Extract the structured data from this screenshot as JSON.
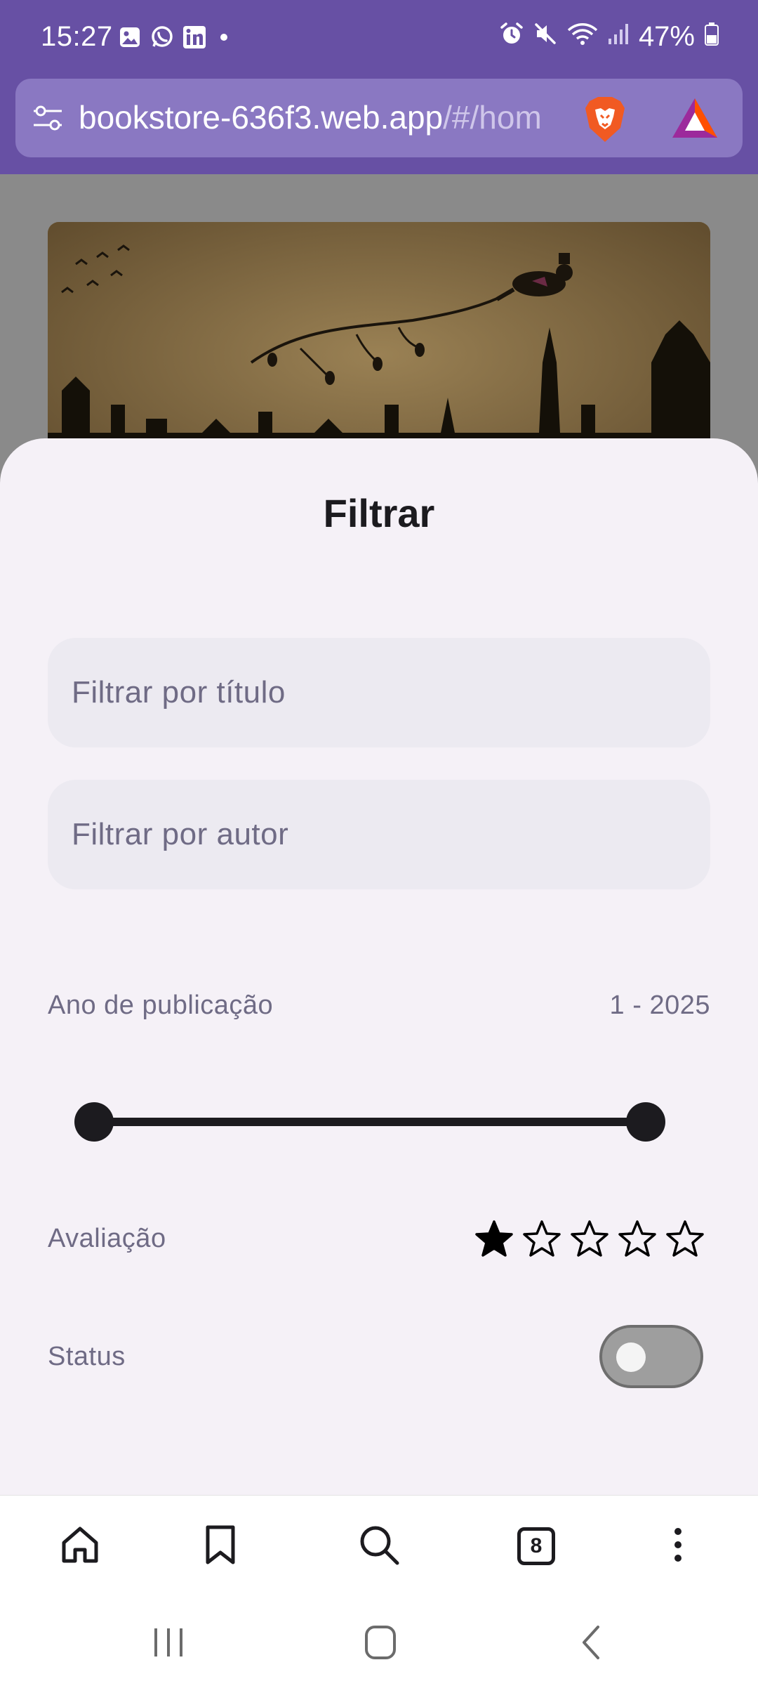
{
  "status_bar": {
    "time": "15:27",
    "battery": "47%",
    "icons": [
      "gallery-icon",
      "whatsapp-icon",
      "linkedin-icon",
      "alarm-icon",
      "mute-icon",
      "wifi-icon",
      "signal-icon",
      "battery-icon"
    ]
  },
  "address_bar": {
    "url_main": "bookstore-636f3.web.app",
    "url_path": "/#/hom"
  },
  "sheet": {
    "title": "Filtrar",
    "title_filter_placeholder": "Filtrar por título",
    "author_filter_placeholder": "Filtrar por autor",
    "year_label": "Ano de publicação",
    "year_range": "1 - 2025",
    "year_min": 1,
    "year_max": 2025,
    "rating_label": "Avaliação",
    "rating": 1,
    "rating_max": 5,
    "status_label": "Status",
    "status_on": false
  },
  "bottom_nav": {
    "tab_count": "8"
  },
  "colors": {
    "brand_purple": "#6750a4",
    "address_bar": "#8a78c2",
    "sheet_bg": "#f5f1f7",
    "field_bg": "#eceaf1",
    "muted_text": "#6f6b85"
  }
}
